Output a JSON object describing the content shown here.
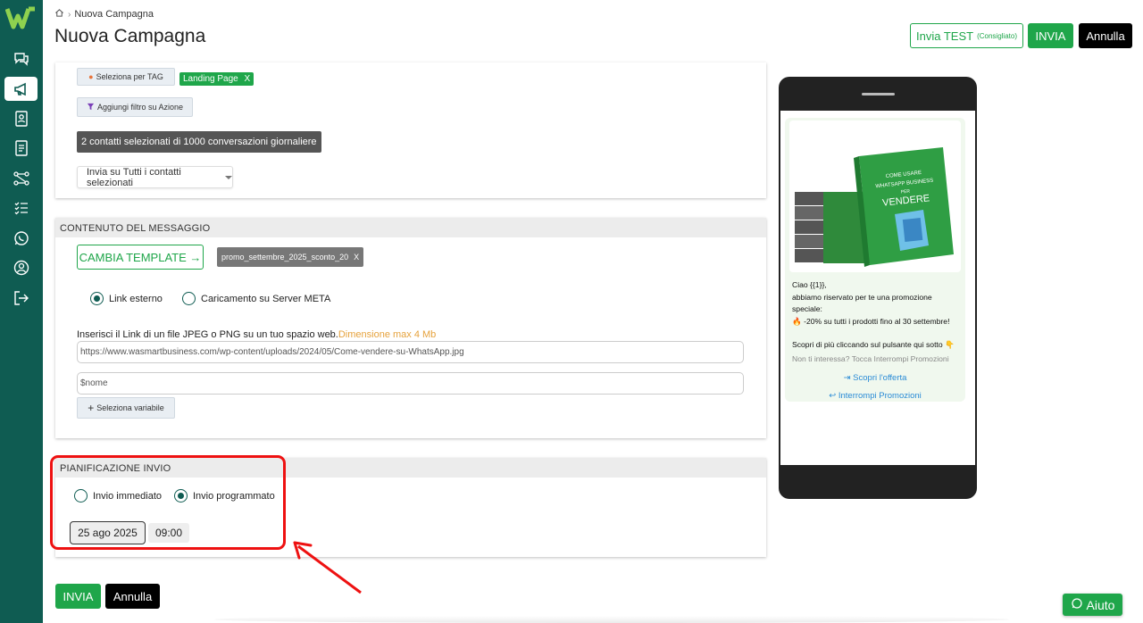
{
  "breadcrumb": {
    "current": "Nuova Campagna"
  },
  "header": {
    "title": "Nuova Campagna",
    "test_label": "Invia TEST",
    "test_hint": "(Consigliato)",
    "send_label": "INVIA",
    "cancel_label": "Annulla"
  },
  "filters": {
    "tag_button": "Seleziona per TAG",
    "tag_chip": "Landing Page",
    "tag_chip_remove": "X",
    "action_button": "Aggiungi filtro su Azione",
    "count_text": "2 contatti selezionati di 1000 conversazioni giornaliere",
    "send_mode": "Invia su Tutti i contatti selezionati"
  },
  "content": {
    "header": "CONTENUTO DEL MESSAGGIO",
    "template_button": "CAMBIA TEMPLATE →",
    "template_chip": "promo_settembre_2025_sconto_20",
    "template_chip_remove": "X",
    "radio_link": "Link esterno",
    "radio_upload": "Caricamento su Server META",
    "hint": "Inserisci il Link di un file JPEG o PNG su un tuo spazio web.",
    "hint_warn": "Dimensione max 4 Mb",
    "url_value": "https://www.wasmartbusiness.com/wp-content/uploads/2024/05/Come-vendere-su-WhatsApp.jpg",
    "var_value": "$nome",
    "variable_button": "Seleziona variabile"
  },
  "schedule": {
    "header": "PIANIFICAZIONE INVIO",
    "radio_now": "Invio immediato",
    "radio_scheduled": "Invio programmato",
    "date": "25 ago 2025",
    "time": "09:00"
  },
  "footer": {
    "send_label": "INVIA",
    "cancel_label": "Annulla"
  },
  "preview": {
    "greeting": "Ciao {{1}},",
    "line1": "abbiamo riservato per te una promozione speciale:",
    "line2": "🔥 -20% su tutti i prodotti fino al 30 settembre!",
    "line3": "Scopri di più cliccando sul pulsante qui sotto 👇",
    "footer": "Non ti interessa? Tocca Interrompi Promozioni",
    "action1": "Scopri l'offerta",
    "action2": "Interrompi Promozioni",
    "book_title_small": "COME USARE",
    "book_title_mid": "WHATSAPP BUSINESS",
    "book_title_per": "PER",
    "book_title_big": "VENDERE"
  },
  "help": {
    "label": "Aiuto"
  },
  "colors": {
    "brand": "#0f5c52",
    "green": "#1fa64a",
    "highlight": "#e11111",
    "link": "#2a8bd6"
  }
}
